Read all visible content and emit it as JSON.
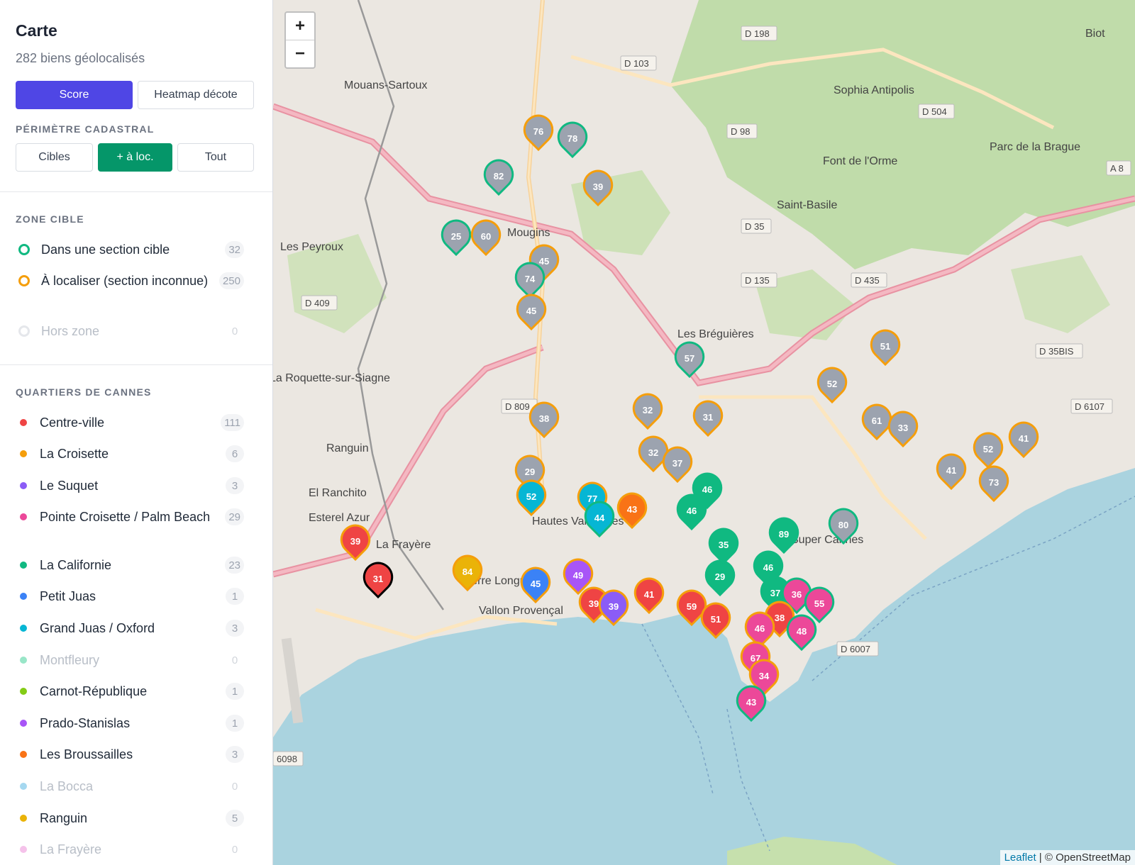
{
  "sidebar": {
    "title": "Carte",
    "subtitle": "282 biens géolocalisés",
    "mode_buttons": [
      "Score",
      "Heatmap décote"
    ],
    "perimeter_label": "PÉRIMÈTRE CADASTRAL",
    "perimeter_buttons": [
      "Cibles",
      "+ à loc.",
      "Tout"
    ],
    "zone_label": "ZONE CIBLE",
    "zone_items": [
      {
        "label": "Dans une section cible",
        "count": "32",
        "color": "#10b981"
      },
      {
        "label": "À localiser (section inconnue)",
        "count": "250",
        "color": "#f59e0b"
      },
      {
        "label": "Hors zone",
        "count": "0",
        "color": "#d1d5db"
      }
    ],
    "quartiers_label": "QUARTIERS DE CANNES",
    "quartiers": [
      {
        "label": "Centre-ville",
        "count": "111",
        "color": "#ef4444"
      },
      {
        "label": "La Croisette",
        "count": "6",
        "color": "#f59e0b"
      },
      {
        "label": "Le Suquet",
        "count": "3",
        "color": "#8b5cf6"
      },
      {
        "label": "Pointe Croisette / Palm Beach",
        "count": "29",
        "color": "#ec4899"
      },
      {
        "label": "La Californie",
        "count": "23",
        "color": "#10b981"
      },
      {
        "label": "Petit Juas",
        "count": "1",
        "color": "#3b82f6"
      },
      {
        "label": "Grand Juas / Oxford",
        "count": "3",
        "color": "#06b6d4"
      },
      {
        "label": "Montfleury",
        "count": "0",
        "color": "#99e6c8"
      },
      {
        "label": "Carnot-République",
        "count": "1",
        "color": "#84cc16"
      },
      {
        "label": "Prado-Stanislas",
        "count": "1",
        "color": "#a855f7"
      },
      {
        "label": "Les Broussailles",
        "count": "3",
        "color": "#f97316"
      },
      {
        "label": "La Bocca",
        "count": "0",
        "color": "#a5d8f0"
      },
      {
        "label": "Ranguin",
        "count": "5",
        "color": "#eab308"
      },
      {
        "label": "La Frayère",
        "count": "0",
        "color": "#f5c2ea"
      }
    ]
  },
  "map": {
    "zoom_in": "+",
    "zoom_out": "−",
    "attribution_link": "Leaflet",
    "attribution_rest": " | © OpenStreetMap",
    "place_labels": [
      "Mouans-Sartoux",
      "Sophia Antipolis",
      "Font de l'Orme",
      "Saint-Basile",
      "Mougins",
      "Les Peyroux",
      "Les Bréguières",
      "La Roquette-sur-Siagne",
      "Ranguin",
      "El Ranchito",
      "Esterel Azur",
      "La Frayère",
      "Pierre Longue",
      "Vallon Provençal",
      "Hautes Vallergues",
      "Super Cannes",
      "Biot",
      "Parc de la Brague"
    ],
    "road_labels": [
      "D 198",
      "D 103",
      "D 504",
      "D 98",
      "D 35",
      "D 135",
      "D 435",
      "D 409",
      "D 809",
      "D 35BIS",
      "D 6107",
      "D 6007",
      "6098",
      "A 8"
    ],
    "markers": [
      {
        "n": "76",
        "c": "#9ca3af",
        "r": "#f59e0b"
      },
      {
        "n": "78",
        "c": "#9ca3af",
        "r": "#10b981"
      },
      {
        "n": "82",
        "c": "#9ca3af",
        "r": "#10b981"
      },
      {
        "n": "39",
        "c": "#9ca3af",
        "r": "#f59e0b"
      },
      {
        "n": "25",
        "c": "#9ca3af",
        "r": "#10b981"
      },
      {
        "n": "60",
        "c": "#9ca3af",
        "r": "#f59e0b"
      },
      {
        "n": "45",
        "c": "#9ca3af",
        "r": "#f59e0b"
      },
      {
        "n": "74",
        "c": "#9ca3af",
        "r": "#10b981"
      },
      {
        "n": "45",
        "c": "#9ca3af",
        "r": "#f59e0b"
      },
      {
        "n": "57",
        "c": "#9ca3af",
        "r": "#10b981"
      },
      {
        "n": "51",
        "c": "#9ca3af",
        "r": "#f59e0b"
      },
      {
        "n": "52",
        "c": "#9ca3af",
        "r": "#f59e0b"
      },
      {
        "n": "32",
        "c": "#9ca3af",
        "r": "#f59e0b"
      },
      {
        "n": "31",
        "c": "#9ca3af",
        "r": "#f59e0b"
      },
      {
        "n": "38",
        "c": "#9ca3af",
        "r": "#f59e0b"
      },
      {
        "n": "61",
        "c": "#9ca3af",
        "r": "#f59e0b"
      },
      {
        "n": "33",
        "c": "#9ca3af",
        "r": "#f59e0b"
      },
      {
        "n": "52",
        "c": "#9ca3af",
        "r": "#f59e0b"
      },
      {
        "n": "41",
        "c": "#9ca3af",
        "r": "#f59e0b"
      },
      {
        "n": "41",
        "c": "#9ca3af",
        "r": "#f59e0b"
      },
      {
        "n": "73",
        "c": "#9ca3af",
        "r": "#f59e0b"
      },
      {
        "n": "32",
        "c": "#9ca3af",
        "r": "#f59e0b"
      },
      {
        "n": "37",
        "c": "#9ca3af",
        "r": "#f59e0b"
      },
      {
        "n": "29",
        "c": "#9ca3af",
        "r": "#f59e0b"
      },
      {
        "n": "52",
        "c": "#06b6d4",
        "r": "#f59e0b"
      },
      {
        "n": "77",
        "c": "#06b6d4",
        "r": "#f59e0b"
      },
      {
        "n": "44",
        "c": "#06b6d4",
        "r": "#10b981"
      },
      {
        "n": "43",
        "c": "#f97316",
        "r": "#f59e0b"
      },
      {
        "n": "46",
        "c": "#10b981",
        "r": "#10b981"
      },
      {
        "n": "46",
        "c": "#10b981",
        "r": "#10b981"
      },
      {
        "n": "89",
        "c": "#10b981",
        "r": "#10b981"
      },
      {
        "n": "80",
        "c": "#9ca3af",
        "r": "#10b981"
      },
      {
        "n": "39",
        "c": "#ef4444",
        "r": "#f59e0b"
      },
      {
        "n": "31",
        "c": "#ef4444",
        "r": "#000000"
      },
      {
        "n": "84",
        "c": "#eab308",
        "r": "#f59e0b"
      },
      {
        "n": "45",
        "c": "#3b82f6",
        "r": "#f59e0b"
      },
      {
        "n": "49",
        "c": "#a855f7",
        "r": "#f59e0b"
      },
      {
        "n": "39",
        "c": "#ef4444",
        "r": "#f59e0b"
      },
      {
        "n": "39",
        "c": "#8b5cf6",
        "r": "#f59e0b"
      },
      {
        "n": "41",
        "c": "#ef4444",
        "r": "#f59e0b"
      },
      {
        "n": "59",
        "c": "#ef4444",
        "r": "#f59e0b"
      },
      {
        "n": "51",
        "c": "#ef4444",
        "r": "#f59e0b"
      },
      {
        "n": "29",
        "c": "#10b981",
        "r": "#10b981"
      },
      {
        "n": "46",
        "c": "#10b981",
        "r": "#10b981"
      },
      {
        "n": "37",
        "c": "#10b981",
        "r": "#10b981"
      },
      {
        "n": "36",
        "c": "#ec4899",
        "r": "#10b981"
      },
      {
        "n": "55",
        "c": "#ec4899",
        "r": "#10b981"
      },
      {
        "n": "38",
        "c": "#ef4444",
        "r": "#f59e0b"
      },
      {
        "n": "46",
        "c": "#ec4899",
        "r": "#f59e0b"
      },
      {
        "n": "48",
        "c": "#ec4899",
        "r": "#10b981"
      },
      {
        "n": "67",
        "c": "#ec4899",
        "r": "#f59e0b"
      },
      {
        "n": "34",
        "c": "#ec4899",
        "r": "#f59e0b"
      },
      {
        "n": "43",
        "c": "#ec4899",
        "r": "#10b981"
      },
      {
        "n": "35",
        "c": "#10b981",
        "r": "#10b981"
      }
    ]
  }
}
